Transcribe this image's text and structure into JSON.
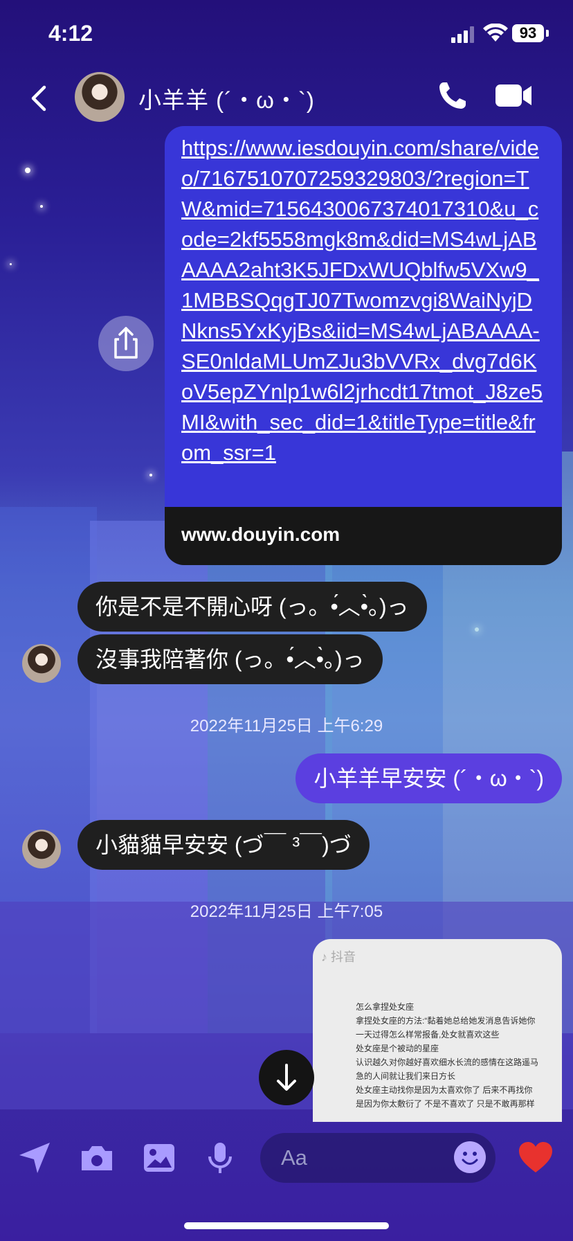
{
  "status": {
    "time": "4:12",
    "battery": "93"
  },
  "header": {
    "contact_name": "小羊羊 (´・ω・`)"
  },
  "link_message": {
    "url_text": "https://www.iesdouyin.com/share/video/7167510707259329803/?region=TW&mid=7156430067374017310&u_code=2kf5558mgk8m&did=MS4wLjABAAAA2aht3K5JFDxWUQblfw5VXw9_1MBBSQqgTJ07Twomzvgi8WaiNyjDNkns5YxKyjBs&iid=MS4wLjABAAAA-SE0nldaMLUmZJu3bVVRx_dvg7d6KoV5epZYnlp1w6l2jrhcdt17tmot_J8ze5MI&with_sec_did=1&titleType=title&from_ssr=1",
    "domain": "www.douyin.com"
  },
  "messages": {
    "in1": "你是不是不開心呀 (っ。•́︿•̀。)っ",
    "in2": "沒事我陪著你 (っ。•́︿•̀。)っ",
    "ts1": "2022年11月25日 上午6:29",
    "out1": "小羊羊早安安 (´・ω・`)",
    "in3": "小貓貓早安安 (づ￣ ³￣)づ",
    "ts2": "2022年11月25日 上午7:05"
  },
  "video_card": {
    "app": "抖音",
    "lines": [
      "怎么拿捏处女座",
      "拿捏处女座的方法:“黏着她总给她发消息告诉她你",
      "一天过得怎么样常报备,处女就喜欢这些",
      "处女座是个被动的星座",
      "认识越久对你越好喜欢细水长流的感情在这路遥马",
      "急的人间就让我们来日方长",
      "处女座主动找你是因为太喜欢你了 后来不再找你",
      "是因为你太敷衍了 不是不喜欢了 只是不敢再那样"
    ]
  },
  "composer": {
    "placeholder": "Aa"
  },
  "icons": {
    "back": "chevron-left-icon",
    "phone": "phone-icon",
    "video": "video-camera-icon",
    "share": "share-icon",
    "scroll": "arrow-down-icon",
    "send": "location-arrow-icon",
    "camera": "camera-icon",
    "gallery": "image-icon",
    "mic": "microphone-icon",
    "emoji": "smiley-icon",
    "like": "heart-icon"
  },
  "colors": {
    "outgoing_bubble": "#5b3fe0",
    "link_bubble": "#3836d8",
    "incoming_bubble": "#1f1f1f",
    "heart": "#e8322e"
  }
}
